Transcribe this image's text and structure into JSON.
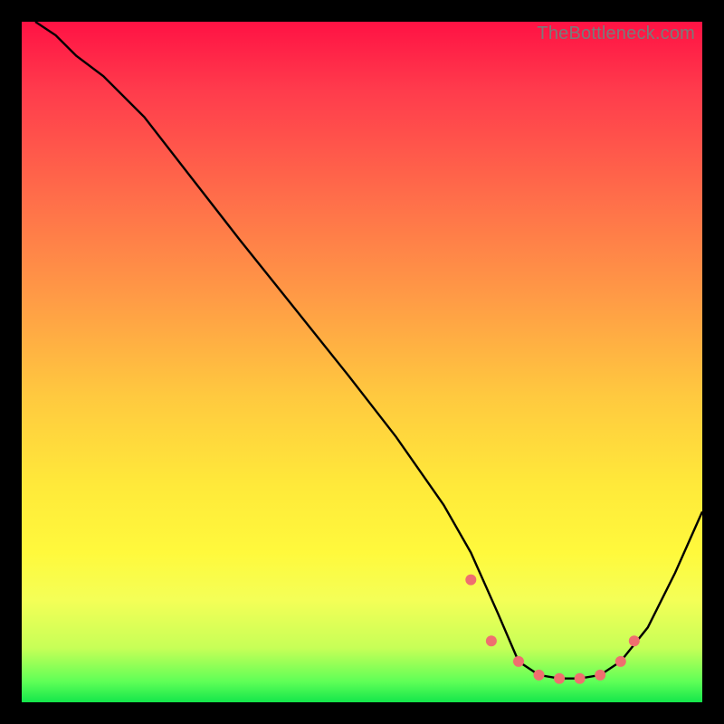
{
  "watermark": "TheBottleneck.com",
  "colors": {
    "background": "#000000",
    "curve_stroke": "#000000",
    "dot_fill": "#ef6f6f",
    "gradient_top": "#ff1244",
    "gradient_bottom": "#14e64b"
  },
  "chart_data": {
    "type": "line",
    "title": "",
    "xlabel": "",
    "ylabel": "",
    "xlim": [
      0,
      100
    ],
    "ylim": [
      0,
      100
    ],
    "grid": false,
    "legend": false,
    "note": "No axis ticks shown; values are estimated in percent of the plot area. Y increases upward. Curve descends steeply then rises after a flat bottom around x≈73–85.",
    "series": [
      {
        "name": "curve",
        "x": [
          2,
          5,
          8,
          12,
          18,
          25,
          32,
          40,
          48,
          55,
          62,
          66,
          70,
          73,
          76,
          79,
          82,
          85,
          88,
          92,
          96,
          100
        ],
        "y": [
          100,
          98,
          95,
          92,
          86,
          77,
          68,
          58,
          48,
          39,
          29,
          22,
          13,
          6,
          4,
          3.5,
          3.5,
          4,
          6,
          11,
          19,
          28
        ]
      }
    ],
    "dots": {
      "name": "highlighted-points",
      "x": [
        66,
        69,
        73,
        76,
        79,
        82,
        85,
        88,
        90
      ],
      "y": [
        18,
        9,
        6,
        4,
        3.5,
        3.5,
        4,
        6,
        9
      ]
    }
  }
}
